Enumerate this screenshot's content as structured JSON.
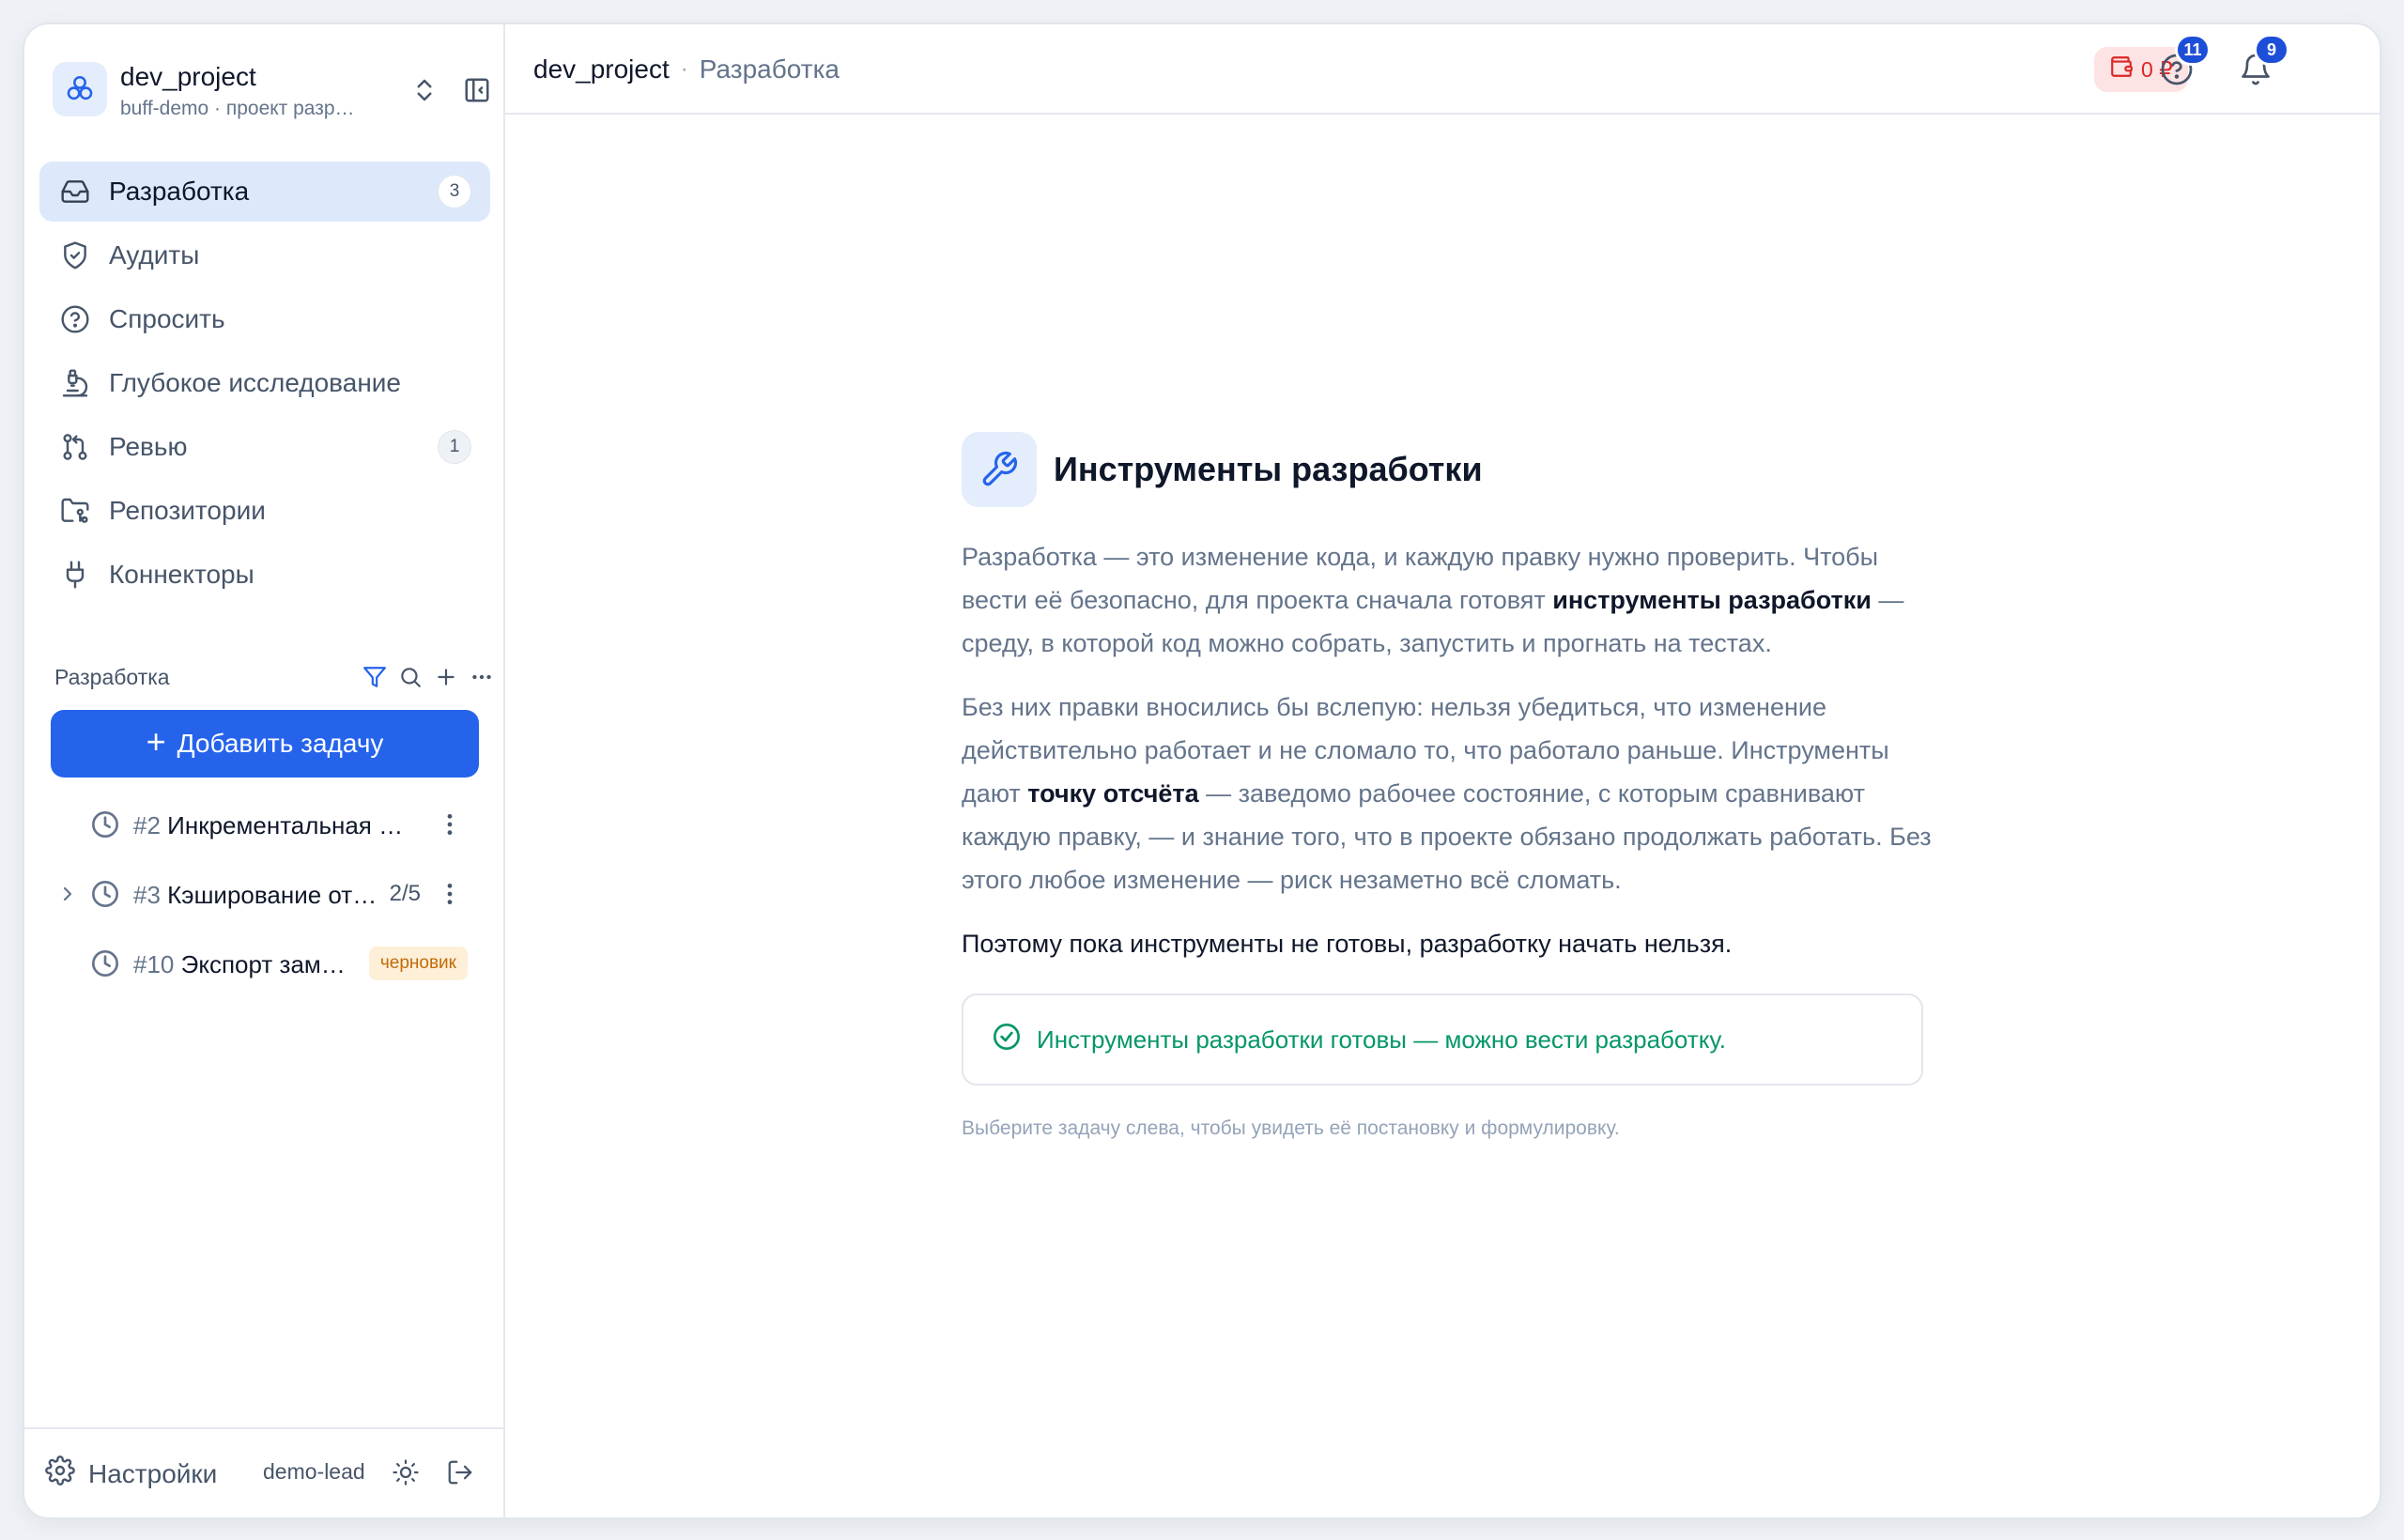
{
  "project": {
    "name": "dev_project",
    "subtitle": "buff-demo · проект разр…"
  },
  "nav": {
    "items": [
      {
        "label": "Разработка",
        "badge": "3",
        "icon": "inbox-icon",
        "active": true
      },
      {
        "label": "Аудиты",
        "icon": "shield-icon"
      },
      {
        "label": "Спросить",
        "icon": "help-circle-icon"
      },
      {
        "label": "Глубокое исследование",
        "icon": "microscope-icon"
      },
      {
        "label": "Ревью",
        "badge": "1",
        "icon": "git-pull-request-icon"
      },
      {
        "label": "Репозитории",
        "icon": "folder-git-icon"
      },
      {
        "label": "Коннекторы",
        "icon": "plug-icon"
      }
    ]
  },
  "tasks_section": {
    "title": "Разработка",
    "add_button": "Добавить задачу",
    "add_icon": "+",
    "tasks": [
      {
        "num": "#2",
        "title": "Инкрементальная и…"
      },
      {
        "num": "#3",
        "title": "Кэширование отв…",
        "progress": "2/5"
      },
      {
        "num": "#10",
        "title": "Экспорт зам…",
        "status": "черновик"
      }
    ]
  },
  "footer": {
    "settings_label": "Настройки",
    "username": "demo-lead"
  },
  "topbar": {
    "breadcrumb_project": "dev_project",
    "breadcrumb_sep": "·",
    "breadcrumb_page": "Разработка",
    "balance": "0 ₽",
    "help_count": "11",
    "notifications_count": "9"
  },
  "main": {
    "title": "Инструменты разработки",
    "p1_a": "Разработка — это изменение кода, и каждую правку нужно проверить. Чтобы вести её безопасно, для проекта сначала готовят ",
    "p1_b": "инструменты разработки",
    "p1_c": " — среду, в которой код можно собрать, запустить и прогнать на тестах.",
    "p2_a": "Без них правки вносились бы вслепую: нельзя убедиться, что изменение действительно работает и не сломало то, что работало раньше. Инструменты дают ",
    "p2_b": "точку отсчёта",
    "p2_c": " — заведомо рабочее состояние, с которым сравнивают каждую правку, — и знание того, что в проекте обязано продолжать работать. Без этого любое изменение — риск незаметно всё сломать.",
    "p3": "Поэтому пока инструменты не готовы, разработку начать нельзя.",
    "ready": "Инструменты разработки готовы — можно вести разработку.",
    "hint": "Выберите задачу слева, чтобы увидеть её постановку и формулировку."
  },
  "colors": {
    "accent": "#2563eb",
    "active_nav_bg": "#dde9fb",
    "success": "#059669",
    "danger": "#dc2626",
    "draft_bg": "#fdefd8",
    "draft_fg": "#c26a07"
  }
}
